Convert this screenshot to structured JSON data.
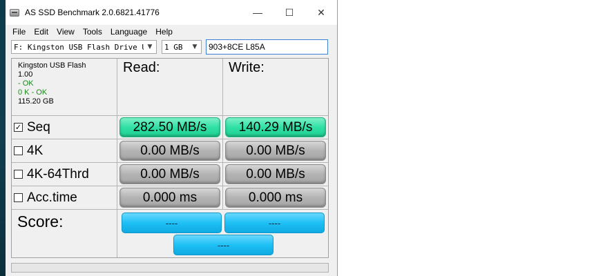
{
  "window": {
    "title": "AS SSD Benchmark 2.0.6821.41776",
    "controls": {
      "minimize": "—",
      "maximize": "☐",
      "close": "✕"
    }
  },
  "menu": [
    "File",
    "Edit",
    "View",
    "Tools",
    "Language",
    "Help"
  ],
  "toolbar": {
    "drive_select": "F: Kingston USB Flash Drive USB D",
    "size_select": "1 GB",
    "name_field": "903+8CE L85A"
  },
  "drive_info": {
    "name": "Kingston USB Flash",
    "version": "1.00",
    "status_1": " - OK",
    "status_2": "0 K - OK",
    "size": "115.20 GB"
  },
  "columns": {
    "read": "Read:",
    "write": "Write:"
  },
  "tests": [
    {
      "label": "Seq",
      "checked": true,
      "read": "282.50 MB/s",
      "write": "140.29 MB/s",
      "state": "done"
    },
    {
      "label": "4K",
      "checked": false,
      "read": "0.00 MB/s",
      "write": "0.00 MB/s",
      "state": "idle"
    },
    {
      "label": "4K-64Thrd",
      "checked": false,
      "read": "0.00 MB/s",
      "write": "0.00 MB/s",
      "state": "idle"
    },
    {
      "label": "Acc.time",
      "checked": false,
      "read": "0.000 ms",
      "write": "0.000 ms",
      "state": "idle"
    }
  ],
  "score": {
    "label": "Score:",
    "read": "----",
    "write": "----",
    "total": "----"
  },
  "checkbox_glyphs": {
    "checked": "✓",
    "unchecked": ""
  },
  "colors": {
    "done": "#2fe0a6",
    "idle": "#b3b3b3",
    "score": "#1ec0f5"
  }
}
